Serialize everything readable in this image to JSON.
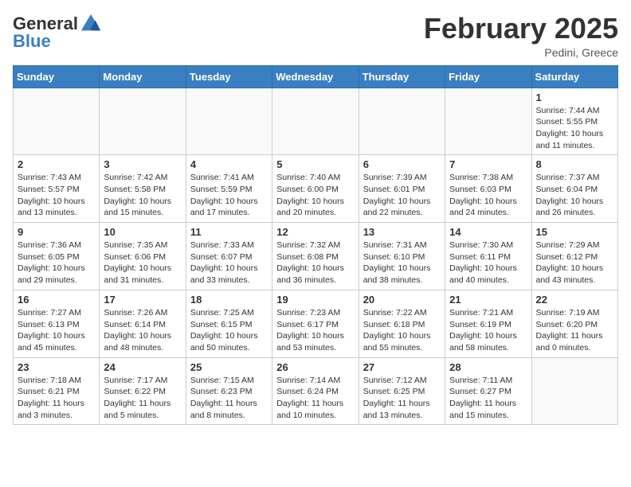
{
  "header": {
    "logo_line1": "General",
    "logo_line2": "Blue",
    "title": "February 2025",
    "subtitle": "Pedini, Greece"
  },
  "days_of_week": [
    "Sunday",
    "Monday",
    "Tuesday",
    "Wednesday",
    "Thursday",
    "Friday",
    "Saturday"
  ],
  "weeks": [
    [
      {
        "day": "",
        "info": ""
      },
      {
        "day": "",
        "info": ""
      },
      {
        "day": "",
        "info": ""
      },
      {
        "day": "",
        "info": ""
      },
      {
        "day": "",
        "info": ""
      },
      {
        "day": "",
        "info": ""
      },
      {
        "day": "1",
        "info": "Sunrise: 7:44 AM\nSunset: 5:55 PM\nDaylight: 10 hours\nand 11 minutes."
      }
    ],
    [
      {
        "day": "2",
        "info": "Sunrise: 7:43 AM\nSunset: 5:57 PM\nDaylight: 10 hours\nand 13 minutes."
      },
      {
        "day": "3",
        "info": "Sunrise: 7:42 AM\nSunset: 5:58 PM\nDaylight: 10 hours\nand 15 minutes."
      },
      {
        "day": "4",
        "info": "Sunrise: 7:41 AM\nSunset: 5:59 PM\nDaylight: 10 hours\nand 17 minutes."
      },
      {
        "day": "5",
        "info": "Sunrise: 7:40 AM\nSunset: 6:00 PM\nDaylight: 10 hours\nand 20 minutes."
      },
      {
        "day": "6",
        "info": "Sunrise: 7:39 AM\nSunset: 6:01 PM\nDaylight: 10 hours\nand 22 minutes."
      },
      {
        "day": "7",
        "info": "Sunrise: 7:38 AM\nSunset: 6:03 PM\nDaylight: 10 hours\nand 24 minutes."
      },
      {
        "day": "8",
        "info": "Sunrise: 7:37 AM\nSunset: 6:04 PM\nDaylight: 10 hours\nand 26 minutes."
      }
    ],
    [
      {
        "day": "9",
        "info": "Sunrise: 7:36 AM\nSunset: 6:05 PM\nDaylight: 10 hours\nand 29 minutes."
      },
      {
        "day": "10",
        "info": "Sunrise: 7:35 AM\nSunset: 6:06 PM\nDaylight: 10 hours\nand 31 minutes."
      },
      {
        "day": "11",
        "info": "Sunrise: 7:33 AM\nSunset: 6:07 PM\nDaylight: 10 hours\nand 33 minutes."
      },
      {
        "day": "12",
        "info": "Sunrise: 7:32 AM\nSunset: 6:08 PM\nDaylight: 10 hours\nand 36 minutes."
      },
      {
        "day": "13",
        "info": "Sunrise: 7:31 AM\nSunset: 6:10 PM\nDaylight: 10 hours\nand 38 minutes."
      },
      {
        "day": "14",
        "info": "Sunrise: 7:30 AM\nSunset: 6:11 PM\nDaylight: 10 hours\nand 40 minutes."
      },
      {
        "day": "15",
        "info": "Sunrise: 7:29 AM\nSunset: 6:12 PM\nDaylight: 10 hours\nand 43 minutes."
      }
    ],
    [
      {
        "day": "16",
        "info": "Sunrise: 7:27 AM\nSunset: 6:13 PM\nDaylight: 10 hours\nand 45 minutes."
      },
      {
        "day": "17",
        "info": "Sunrise: 7:26 AM\nSunset: 6:14 PM\nDaylight: 10 hours\nand 48 minutes."
      },
      {
        "day": "18",
        "info": "Sunrise: 7:25 AM\nSunset: 6:15 PM\nDaylight: 10 hours\nand 50 minutes."
      },
      {
        "day": "19",
        "info": "Sunrise: 7:23 AM\nSunset: 6:17 PM\nDaylight: 10 hours\nand 53 minutes."
      },
      {
        "day": "20",
        "info": "Sunrise: 7:22 AM\nSunset: 6:18 PM\nDaylight: 10 hours\nand 55 minutes."
      },
      {
        "day": "21",
        "info": "Sunrise: 7:21 AM\nSunset: 6:19 PM\nDaylight: 10 hours\nand 58 minutes."
      },
      {
        "day": "22",
        "info": "Sunrise: 7:19 AM\nSunset: 6:20 PM\nDaylight: 11 hours\nand 0 minutes."
      }
    ],
    [
      {
        "day": "23",
        "info": "Sunrise: 7:18 AM\nSunset: 6:21 PM\nDaylight: 11 hours\nand 3 minutes."
      },
      {
        "day": "24",
        "info": "Sunrise: 7:17 AM\nSunset: 6:22 PM\nDaylight: 11 hours\nand 5 minutes."
      },
      {
        "day": "25",
        "info": "Sunrise: 7:15 AM\nSunset: 6:23 PM\nDaylight: 11 hours\nand 8 minutes."
      },
      {
        "day": "26",
        "info": "Sunrise: 7:14 AM\nSunset: 6:24 PM\nDaylight: 11 hours\nand 10 minutes."
      },
      {
        "day": "27",
        "info": "Sunrise: 7:12 AM\nSunset: 6:25 PM\nDaylight: 11 hours\nand 13 minutes."
      },
      {
        "day": "28",
        "info": "Sunrise: 7:11 AM\nSunset: 6:27 PM\nDaylight: 11 hours\nand 15 minutes."
      },
      {
        "day": "",
        "info": ""
      }
    ]
  ]
}
